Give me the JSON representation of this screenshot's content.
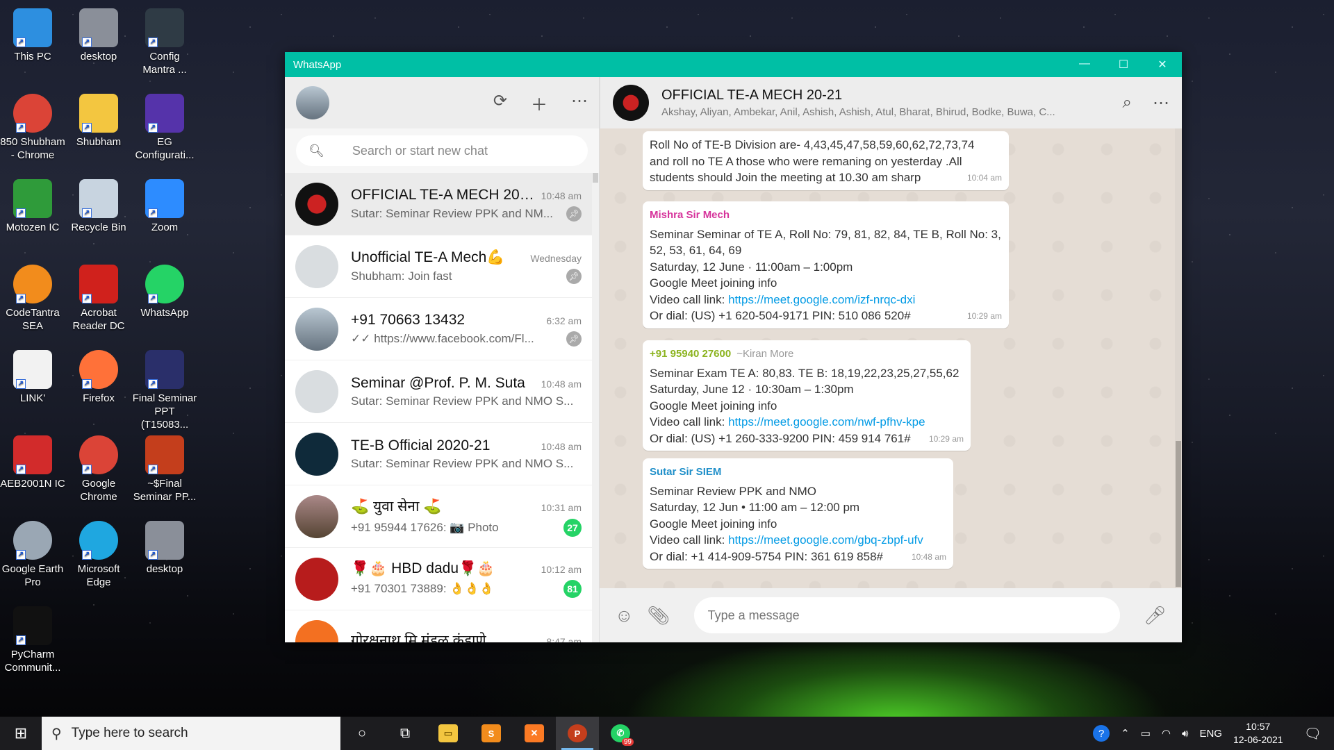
{
  "desktop": {
    "icons": [
      {
        "label": "This PC",
        "icon": "computer-icon",
        "color": "#2d8fe0"
      },
      {
        "label": "desktop",
        "icon": "file-icon",
        "color": "#8a8f99"
      },
      {
        "label": "Config Mantra ...",
        "icon": "app-icon",
        "color": "#2f3b45"
      },
      {
        "label": "850 Shubham - Chrome",
        "icon": "chrome-icon",
        "color": "#db4437"
      },
      {
        "label": "Shubham",
        "icon": "folder-user-icon",
        "color": "#f3c640"
      },
      {
        "label": "EG Configurati...",
        "icon": "eg-icon",
        "color": "#5533aa"
      },
      {
        "label": "Motozen IC",
        "icon": "motozen-icon",
        "color": "#2f9b3a"
      },
      {
        "label": "Recycle Bin",
        "icon": "recycle-bin-icon",
        "color": "#c8d4e0"
      },
      {
        "label": "Zoom",
        "icon": "zoom-icon",
        "color": "#2d8cff"
      },
      {
        "label": "CodeTantra SEA",
        "icon": "codetantra-icon",
        "color": "#f28c1c"
      },
      {
        "label": "Acrobat Reader DC",
        "icon": "acrobat-icon",
        "color": "#d0211c"
      },
      {
        "label": "WhatsApp",
        "icon": "whatsapp-icon",
        "color": "#25d366"
      },
      {
        "label": "LINK'",
        "icon": "document-icon",
        "color": "#f2f2f2"
      },
      {
        "label": "Firefox",
        "icon": "firefox-icon",
        "color": "#ff7139"
      },
      {
        "label": "Final Seminar PPT (T15083...",
        "icon": "ppt-file-icon",
        "color": "#2a2f6a"
      },
      {
        "label": "AEB2001N IC",
        "icon": "deb-icon",
        "color": "#d22b2b"
      },
      {
        "label": "Google Chrome",
        "icon": "chrome-icon",
        "color": "#db4437"
      },
      {
        "label": "~$Final Seminar PP...",
        "icon": "powerpoint-icon",
        "color": "#c43e1c"
      },
      {
        "label": "Google Earth Pro",
        "icon": "google-earth-icon",
        "color": "#9aa7b4"
      },
      {
        "label": "Microsoft Edge",
        "icon": "edge-icon",
        "color": "#1fa7e0"
      },
      {
        "label": "desktop",
        "icon": "file-icon",
        "color": "#8a8f99"
      },
      {
        "label": "PyCharm Communit...",
        "icon": "pycharm-icon",
        "color": "#111111"
      }
    ]
  },
  "window": {
    "title": "WhatsApp",
    "controls": {
      "minimize": "—",
      "maximize": "☐",
      "close": "✕"
    },
    "accent": "#00bfa5"
  },
  "sidebar": {
    "search_placeholder": "Search or start new chat",
    "chats": [
      {
        "name": "OFFICIAL TE-A MECH 20-...",
        "time": "10:48 am",
        "preview": "Sutar: Seminar Review PPK and NM...",
        "pinned": true,
        "selected": true
      },
      {
        "name": "Unofficial TE-A Mech💪",
        "time": "Wednesday",
        "preview": "Shubham: Join fast",
        "pinned": true
      },
      {
        "name": "+91 70663 13432",
        "time": "6:32 am",
        "preview": "✓✓ https://www.facebook.com/Fl...",
        "pinned": true
      },
      {
        "name": "Seminar @Prof. P. M. Suta",
        "time": "10:48 am",
        "preview": "Sutar: Seminar Review PPK and NMO S..."
      },
      {
        "name": "TE-B Official 2020-21",
        "time": "10:48 am",
        "preview": "Sutar: Seminar Review PPK and NMO S..."
      },
      {
        "name": "⛳ युवा सेना ⛳",
        "time": "10:31 am",
        "preview": "+91 95944 17626: 📷 Photo",
        "badge": "27"
      },
      {
        "name": "🌹🎂 HBD dadu🌹🎂",
        "time": "10:12 am",
        "preview": "+91 70301 73889: 👌👌👌",
        "badge": "81"
      },
      {
        "name": "गोरक्षनाथ मि मंडळ कुंडाणे",
        "time": "8:47 am",
        "preview": ""
      }
    ]
  },
  "conversation": {
    "name": "OFFICIAL TE-A MECH 20-21",
    "members": "Akshay, Aliyan, Ambekar, Anil, Ashish, Ashish, Atul, Bharat, Bhirud, Bodke, Buwa, C...",
    "messages": [
      {
        "sender": "",
        "lines": [
          "Roll No of TE-B Division are- 4,43,45,47,58,59,60,62,72,73,74",
          "and roll no TE A those who were remaning on yesterday .All",
          "students should Join the meeting at 10.30 am sharp"
        ],
        "time": "10:04 am"
      },
      {
        "sender": "Mishra Sir Mech",
        "sender_color": "#d6339b",
        "lines": [
          "Seminar Seminar of TE A, Roll No: 79, 81, 82, 84, TE B, Roll No: 3,",
          "52, 53, 61, 64, 69",
          "Saturday, 12 June · 11:00am – 1:00pm",
          "Google Meet joining info"
        ],
        "link_prefix": "Video call link: ",
        "link": "https://meet.google.com/izf-nrqc-dxi",
        "after": "Or dial: (US) +1 620-504-9171 PIN: 510 086 520#",
        "time": "10:29 am"
      },
      {
        "sender": "+91 95940 27600",
        "alias": "~Kiran More",
        "sender_color": "#8bb31e",
        "lines": [
          "Seminar Exam TE A: 80,83. TE B: 18,19,22,23,25,27,55,62",
          "Saturday, June 12 · 10:30am – 1:30pm",
          "Google Meet joining info"
        ],
        "link_prefix": "Video call link: ",
        "link": "https://meet.google.com/nwf-pfhv-kpe",
        "after": "Or dial: (US) +1 260-333-9200 PIN: 459 914 761#",
        "time": "10:29 am"
      },
      {
        "sender": "Sutar Sir SIEM",
        "sender_color": "#1f8fc9",
        "lines": [
          "Seminar Review PPK and NMO",
          "Saturday, 12 Jun  •  11:00 am – 12:00 pm",
          "Google Meet joining info"
        ],
        "link_prefix": "Video call link: ",
        "link": "https://meet.google.com/gbq-zbpf-ufv",
        "after": "Or dial: +1 414-909-5754 PIN: 361 619 858#",
        "time": "10:48 am"
      }
    ],
    "compose_placeholder": "Type a message"
  },
  "taskbar": {
    "search_placeholder": "Type here to search",
    "whatsapp_badge": "99",
    "language": "ENG",
    "time": "10:57",
    "date": "12-06-2021"
  }
}
